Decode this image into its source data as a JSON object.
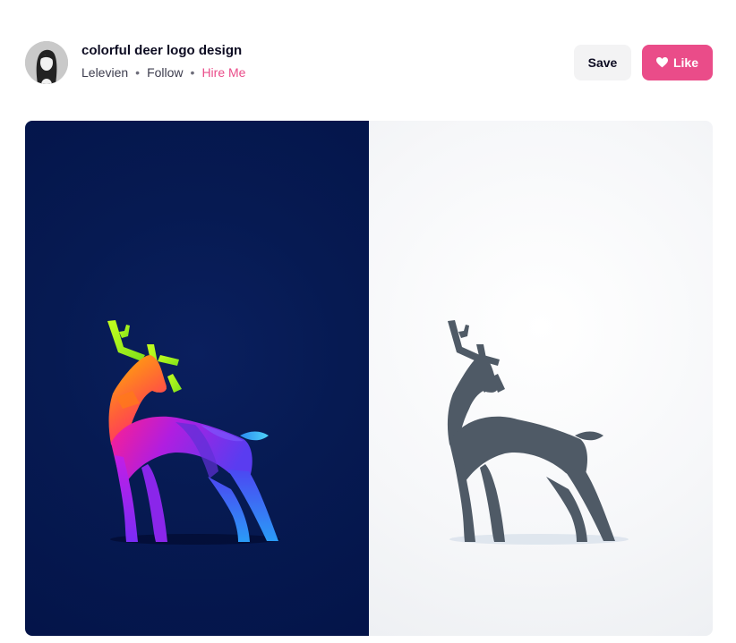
{
  "shot": {
    "title": "colorful deer logo design",
    "author": "Lelevien",
    "follow_label": "Follow",
    "hire_label": "Hire Me",
    "separator": "•"
  },
  "actions": {
    "save_label": "Save",
    "like_label": "Like"
  },
  "icons": {
    "like": "heart-icon"
  },
  "colors": {
    "accent": "#ea4c89",
    "save_bg": "#f3f3f4",
    "left_panel_bg": "#061a52",
    "right_panel_bg": "#f6f7f9",
    "deer_gray": "#4f5a66"
  }
}
